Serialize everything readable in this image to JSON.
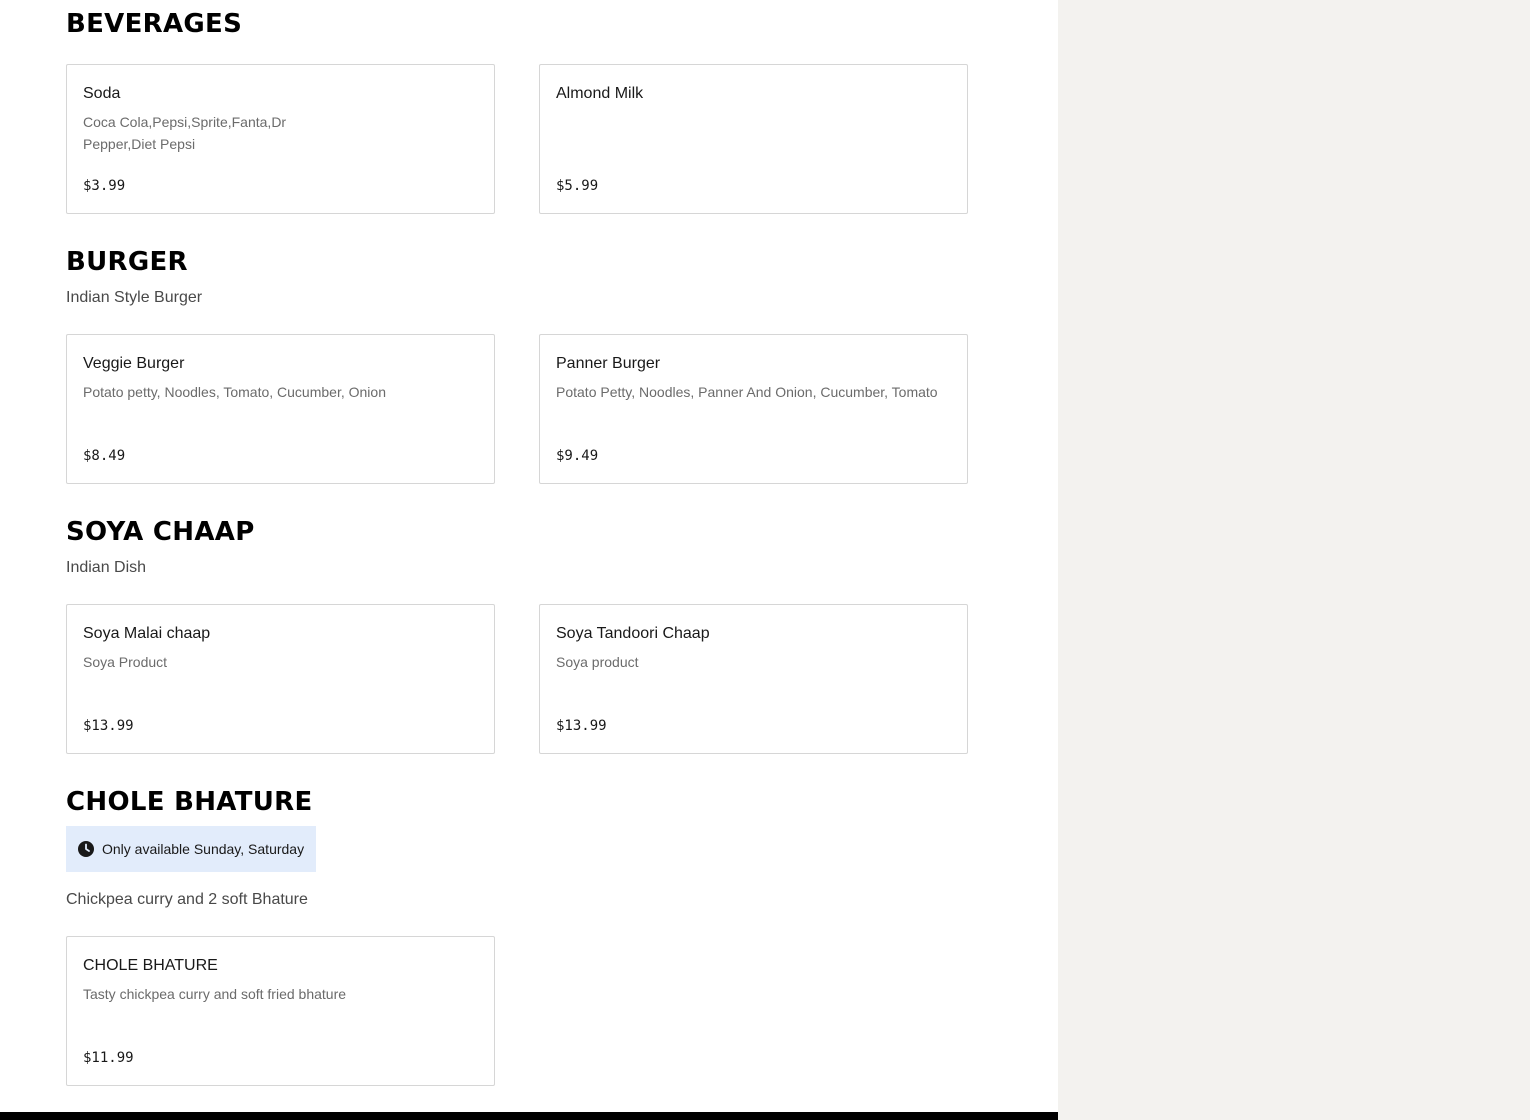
{
  "sections": {
    "beverages": {
      "title": "BEVERAGES",
      "items": [
        {
          "name": "Soda",
          "description": "Coca Cola,Pepsi,Sprite,Fanta,Dr Pepper,Diet Pepsi",
          "price": "$3.99"
        },
        {
          "name": "Almond Milk",
          "description": "",
          "price": "$5.99"
        }
      ]
    },
    "burger": {
      "title": "BURGER",
      "description": "Indian Style Burger",
      "items": [
        {
          "name": "Veggie Burger",
          "description": "Potato petty, Noodles, Tomato, Cucumber, Onion",
          "price": "$8.49"
        },
        {
          "name": "Panner Burger",
          "description": "Potato Petty, Noodles, Panner And Onion, Cucumber, Tomato",
          "price": "$9.49"
        }
      ]
    },
    "soya_chaap": {
      "title": "SOYA CHAAP",
      "description": "Indian Dish",
      "items": [
        {
          "name": "Soya Malai chaap",
          "description": "Soya Product",
          "price": "$13.99"
        },
        {
          "name": "Soya Tandoori Chaap",
          "description": "Soya product",
          "price": "$13.99"
        }
      ]
    },
    "chole_bhature": {
      "title": "CHOLE BHATURE",
      "availability": "Only available Sunday, Saturday",
      "availability_icon": "clock-icon",
      "description": "Chickpea curry and 2 soft Bhature",
      "items": [
        {
          "name": "CHOLE BHATURE",
          "description": "Tasty chickpea curry and soft fried bhature",
          "price": "$11.99"
        }
      ]
    }
  },
  "colors": {
    "sidebar_background": "#f3f2ef",
    "badge_background": "#e2ecfb",
    "card_border": "#d6d6d6",
    "footer": "#000000"
  }
}
